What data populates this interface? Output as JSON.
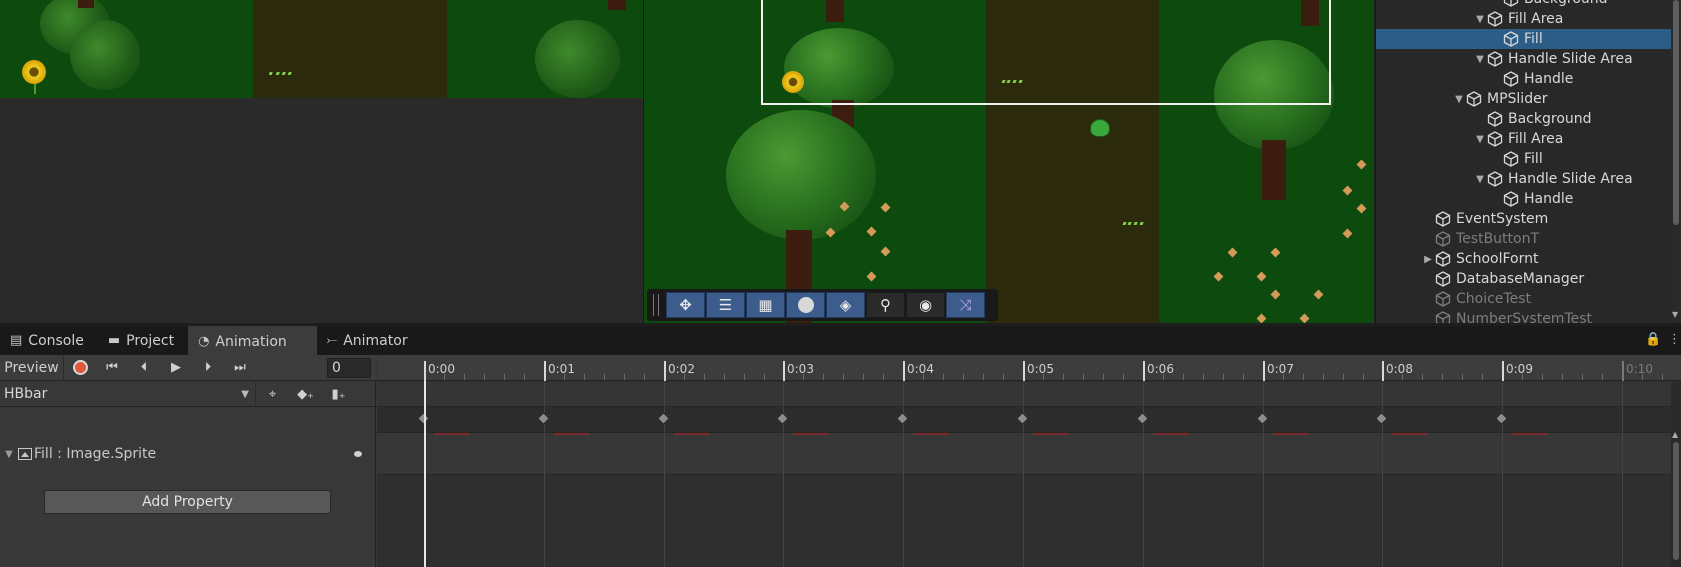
{
  "hierarchy": {
    "items": [
      {
        "label": "Background",
        "state": "normal"
      },
      {
        "label": "Fill Area",
        "state": "expanded"
      },
      {
        "label": "Fill",
        "state": "selected"
      },
      {
        "label": "Handle Slide Area",
        "state": "expanded"
      },
      {
        "label": "Handle",
        "state": "normal"
      },
      {
        "label": "MPSlider",
        "state": "expanded"
      },
      {
        "label": "Background",
        "state": "normal"
      },
      {
        "label": "Fill Area",
        "state": "expanded"
      },
      {
        "label": "Fill",
        "state": "normal"
      },
      {
        "label": "Handle Slide Area",
        "state": "expanded"
      },
      {
        "label": "Handle",
        "state": "normal"
      },
      {
        "label": "EventSystem",
        "state": "normal"
      },
      {
        "label": "TestButtonT",
        "state": "inactive"
      },
      {
        "label": "SchoolFornt",
        "state": "collapsed"
      },
      {
        "label": "DatabaseManager",
        "state": "normal"
      },
      {
        "label": "ChoiceTest",
        "state": "inactive"
      },
      {
        "label": "NumberSystemTest",
        "state": "inactive"
      }
    ]
  },
  "scene_toolbar": {
    "tools": [
      "move-tool-icon",
      "rect-tool-icon",
      "grid-snap-icon",
      "shading-sphere-icon",
      "layers-icon",
      "search-icon",
      "camera-visibility-icon",
      "shuffle-icon"
    ]
  },
  "tabs": [
    {
      "label": "Console",
      "icon": "console-icon",
      "active": false
    },
    {
      "label": "Project",
      "icon": "folder-icon",
      "active": false
    },
    {
      "label": "Animation",
      "icon": "clock-icon",
      "active": true
    },
    {
      "label": "Animator",
      "icon": "animator-icon",
      "active": false
    }
  ],
  "animation": {
    "preview_label": "Preview",
    "frame_value": "0",
    "clip_name": "HBbar",
    "property_label": "Fill : Image.Sprite",
    "add_property_label": "Add Property",
    "timeline": {
      "labels": [
        "0:00",
        "0:01",
        "0:02",
        "0:03",
        "0:04",
        "0:05",
        "0:06",
        "0:07",
        "0:08",
        "0:09",
        "0:10"
      ],
      "keyframe_times": [
        "0:00",
        "0:01",
        "0:02",
        "0:03",
        "0:04",
        "0:05",
        "0:06",
        "0:07",
        "0:08",
        "0:09"
      ],
      "playhead": "0:00"
    }
  },
  "colors": {
    "accent_selected": "#2c5d87",
    "record_red": "#e0583c",
    "grass_green": "#0d4a0d",
    "path_brown": "#2b2a0c"
  }
}
